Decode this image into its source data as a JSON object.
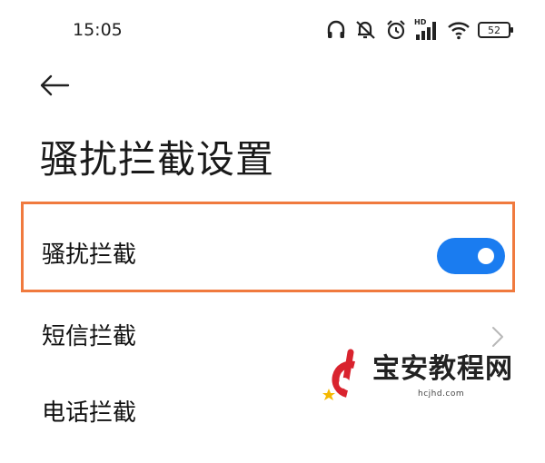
{
  "status_bar": {
    "time": "15:05",
    "hd_label": "HD",
    "battery_level": "52",
    "icons": [
      "headphones-icon",
      "mute-vibrate-icon",
      "alarm-icon",
      "signal-icon",
      "wifi-icon",
      "battery-icon"
    ]
  },
  "header": {
    "back_icon": "arrow-left-icon",
    "title": "骚扰拦截设置"
  },
  "settings": {
    "items": [
      {
        "label": "骚扰拦截",
        "control": "toggle",
        "enabled": true
      },
      {
        "label": "短信拦截",
        "control": "chevron-right-icon"
      },
      {
        "label": "电话拦截",
        "control": "chevron-right-icon"
      }
    ]
  },
  "colors": {
    "accent": "#1a7cf0",
    "highlight_border": "#f07a3e",
    "text": "#1a1a1a",
    "background": "#ffffff"
  },
  "watermark": {
    "title": "宝安教程网",
    "url": "hcjhd.com"
  }
}
